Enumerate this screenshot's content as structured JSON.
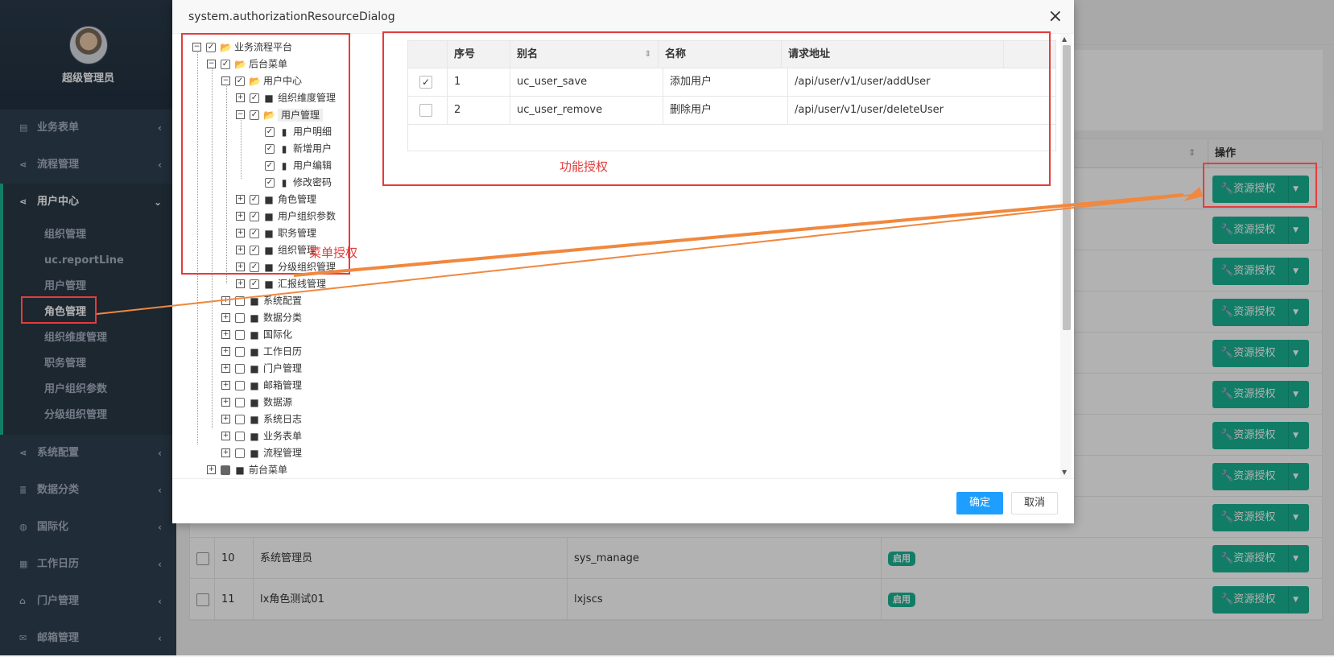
{
  "sidebar": {
    "user_name": "超级管理员",
    "items": [
      {
        "label": "业务表单",
        "icon": "list-icon"
      },
      {
        "label": "流程管理",
        "icon": "share-icon"
      },
      {
        "label": "用户中心",
        "icon": "share-icon"
      },
      {
        "label": "系统配置",
        "icon": "share-icon"
      },
      {
        "label": "数据分类",
        "icon": "database-icon"
      },
      {
        "label": "国际化",
        "icon": "globe-icon"
      },
      {
        "label": "工作日历",
        "icon": "calendar-icon"
      },
      {
        "label": "门户管理",
        "icon": "home-icon"
      },
      {
        "label": "邮箱管理",
        "icon": "mail-icon"
      }
    ],
    "submenu": [
      "组织管理",
      "uc.reportLine",
      "用户管理",
      "角色管理",
      "组织维度管理",
      "职务管理",
      "用户组织参数",
      "分级组织管理"
    ]
  },
  "grid": {
    "op_header": "操作",
    "btn_label": "资源授权",
    "rows": [
      {
        "no": "10",
        "name": "系统管理员",
        "alias": "sys_manage",
        "status": "启用"
      },
      {
        "no": "11",
        "name": "lx角色测试01",
        "alias": "lxjscs",
        "status": "启用"
      }
    ]
  },
  "dialog": {
    "title": "system.authorizationResourceDialog",
    "ok": "确定",
    "cancel": "取消",
    "menu_annotation": "菜单授权",
    "func_annotation": "功能授权",
    "tree": [
      "业务流程平台",
      "后台菜单",
      "用户中心",
      "组织维度管理",
      "用户管理",
      "用户明细",
      "新增用户",
      "用户编辑",
      "修改密码",
      "角色管理",
      "用户组织参数",
      "职务管理",
      "组织管理",
      "分级组织管理",
      "汇报线管理",
      "系统配置",
      "数据分类",
      "国际化",
      "工作日历",
      "门户管理",
      "邮箱管理",
      "数据源",
      "系统日志",
      "业务表单",
      "流程管理",
      "前台菜单"
    ],
    "func_table": {
      "headers": [
        "序号",
        "别名",
        "名称",
        "请求地址"
      ],
      "rows": [
        {
          "no": "1",
          "alias": "uc_user_save",
          "name": "添加用户",
          "url": "/api/user/v1/user/addUser",
          "checked": true
        },
        {
          "no": "2",
          "alias": "uc_user_remove",
          "name": "删除用户",
          "url": "/api/user/v1/user/deleteUser",
          "checked": false
        }
      ]
    }
  },
  "colors": {
    "accent": "#1ab394",
    "annotation": "#e43c3c",
    "arrow": "#f0883e",
    "primary": "#1e9fff"
  }
}
